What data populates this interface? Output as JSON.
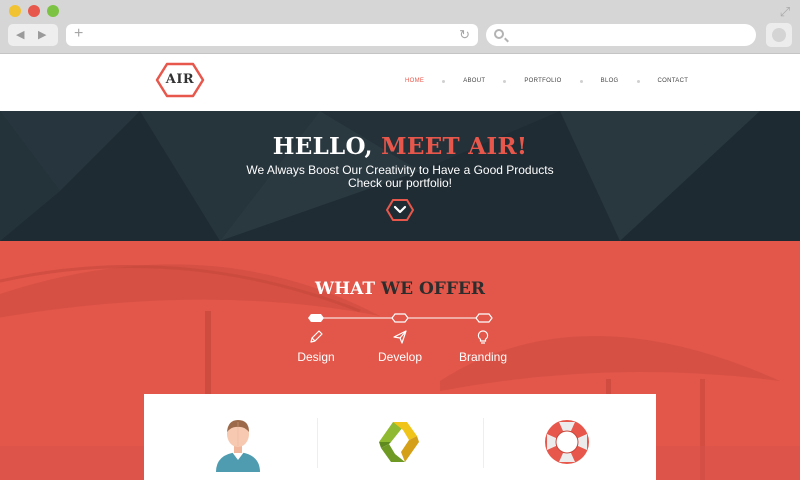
{
  "browser": {
    "url": "",
    "search_placeholder": ""
  },
  "site": {
    "logo_text": "AIR",
    "nav": [
      {
        "label": "HOME",
        "active": true
      },
      {
        "label": "ABOUT",
        "active": false
      },
      {
        "label": "PORTFOLIO",
        "active": false
      },
      {
        "label": "BLOG",
        "active": false
      },
      {
        "label": "CONTACT",
        "active": false
      }
    ]
  },
  "hero": {
    "title_prefix": "HELLO, ",
    "title_accent": "MEET AIR!",
    "subtitle_line1": "We Always Boost Our Creativity to Have a Good Products",
    "subtitle_line2": "Check our portfolio!"
  },
  "offer": {
    "title_light": "WHAT ",
    "title_dark": "WE OFFER",
    "services": [
      {
        "label": "Design",
        "icon": "pencil-icon"
      },
      {
        "label": "Develop",
        "icon": "paper-plane-icon"
      },
      {
        "label": "Branding",
        "icon": "lightbulb-icon"
      }
    ],
    "features": [
      {
        "icon": "user-avatar-icon"
      },
      {
        "icon": "recycle-arrows-icon"
      },
      {
        "icon": "lifebuoy-icon"
      }
    ]
  },
  "colors": {
    "accent": "#e8574b",
    "hero_bg": "#233038",
    "offer_bg": "#e2574a"
  }
}
